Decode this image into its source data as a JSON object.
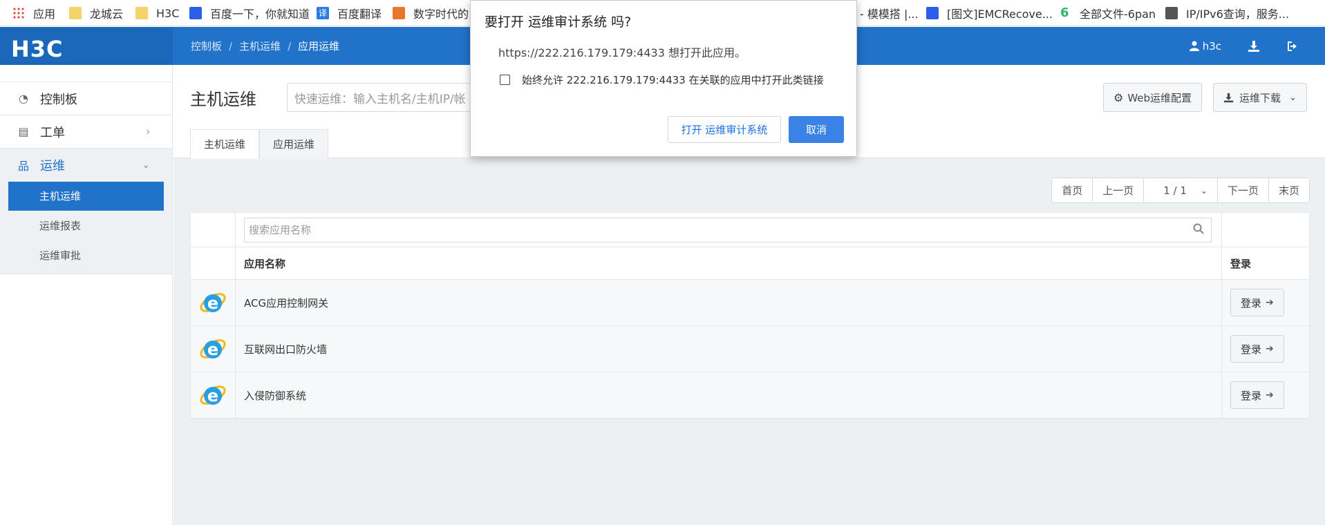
{
  "bookmarks": [
    {
      "label": "应用",
      "icon": "apps-icon"
    },
    {
      "label": "龙城云",
      "icon": "folder-icon"
    },
    {
      "label": "H3C",
      "icon": "folder-icon"
    },
    {
      "label": "百度一下，你就知道",
      "icon": "baidu-icon"
    },
    {
      "label": "百度翻译",
      "icon": "translate-icon"
    },
    {
      "label": "数字时代的",
      "icon": "site-icon"
    },
    {
      "label": "- 模模搭 |...",
      "icon": ""
    },
    {
      "label": "[图文]EMCRecove...",
      "icon": "baidu-icon"
    },
    {
      "label": "全部文件-6pan",
      "icon": "sixpan-icon"
    },
    {
      "label": "IP/IPv6查询，服务...",
      "icon": "globe-icon"
    }
  ],
  "header": {
    "logo": "H3C",
    "breadcrumb": [
      "控制板",
      "主机运维",
      "应用运维"
    ],
    "user": "h3c"
  },
  "sidebar": {
    "items": [
      {
        "label": "控制板"
      },
      {
        "label": "工单"
      },
      {
        "label": "运维"
      }
    ],
    "submenu": [
      {
        "label": "主机运维"
      },
      {
        "label": "运维报表"
      },
      {
        "label": "运维审批"
      }
    ]
  },
  "main": {
    "title": "主机运维",
    "quick_placeholder": "快速运维：输入主机名/主机IP/帐",
    "web_config": "Web运维配置",
    "download": "运维下载",
    "tabs": [
      "主机运维",
      "应用运维"
    ],
    "pager": {
      "first": "首页",
      "prev": "上一页",
      "page": "1 / 1",
      "next": "下一页",
      "last": "末页"
    },
    "search_placeholder": "搜索应用名称",
    "columns": {
      "name": "应用名称",
      "login": "登录"
    },
    "rows": [
      {
        "name": "ACG应用控制网关",
        "login": "登录"
      },
      {
        "name": "互联网出口防火墙",
        "login": "登录"
      },
      {
        "name": "入侵防御系统",
        "login": "登录"
      }
    ]
  },
  "dialog": {
    "title": "要打开 运维审计系统 吗?",
    "message": "https://222.216.179.179:4433 想打开此应用。",
    "checkbox": "始终允许 222.216.179.179:4433 在关联的应用中打开此类链接",
    "open_button": "打开 运维审计系统",
    "cancel_button": "取消"
  },
  "colors": {
    "brand": "#2172c9",
    "accent_button": "#3b82e6"
  }
}
